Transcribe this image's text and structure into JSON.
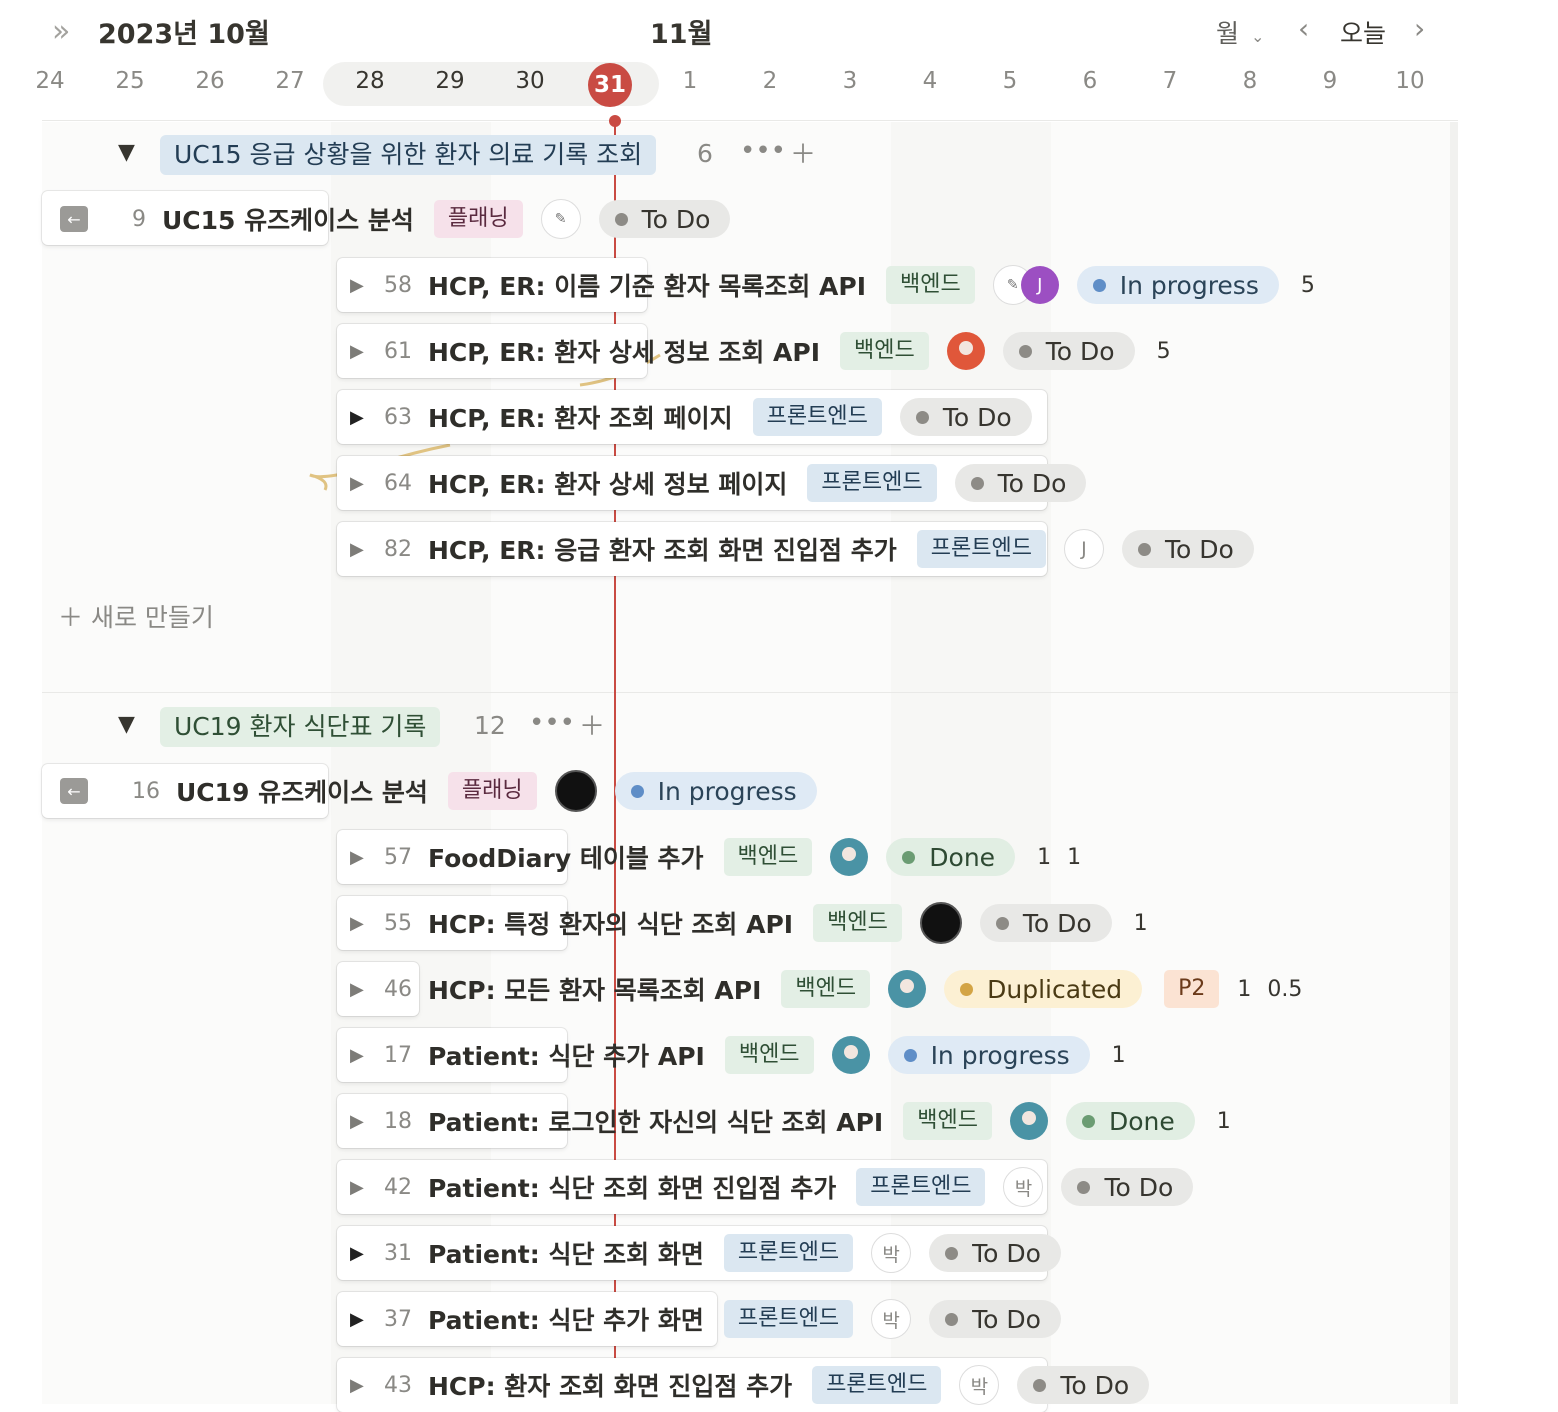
{
  "header": {
    "collapse_icon": "double-chevron-right-icon",
    "current_month": "2023년 10월",
    "next_month": "11월",
    "view_selector": "월",
    "today_button": "오늘",
    "days": [
      "24",
      "25",
      "26",
      "27",
      "28",
      "29",
      "30",
      "31",
      "1",
      "2",
      "3",
      "4",
      "5",
      "6",
      "7",
      "8",
      "9",
      "10"
    ],
    "today": "31",
    "today_color": "#c94b43"
  },
  "groups": [
    {
      "title": "UC15 응급 상황을 위한 환자 의료 기록 조회",
      "count": "6",
      "color": "#dbe7f1",
      "parent": {
        "num": "9",
        "title": "UC15 유즈케이스 분석",
        "tag": "플래닝",
        "status": "To Do"
      },
      "items": [
        {
          "num": "58",
          "title": "HCP, ER: 이름 기준 환자 목록조회 API",
          "tag": "백엔드",
          "avatars": [
            "sketch",
            "J"
          ],
          "status": "In progress",
          "extra": [
            "5"
          ]
        },
        {
          "num": "61",
          "title": "HCP, ER: 환자 상세 정보 조회 API",
          "tag": "백엔드",
          "avatars": [
            "orange"
          ],
          "status": "To Do",
          "extra": [
            "5"
          ]
        },
        {
          "num": "63",
          "title": "HCP, ER: 환자 조회 페이지",
          "tag": "프론트엔드",
          "avatars": [],
          "status": "To Do",
          "extra": []
        },
        {
          "num": "64",
          "title": "HCP, ER: 환자 상세 정보 페이지",
          "tag": "프론트엔드",
          "avatars": [],
          "status": "To Do",
          "extra": []
        },
        {
          "num": "82",
          "title": "HCP, ER: 응급 환자 조회 화면 진입점 추가",
          "tag": "프론트엔드",
          "avatars": [
            "J"
          ],
          "status": "To Do",
          "extra": []
        }
      ],
      "new_label": "새로 만들기"
    },
    {
      "title": "UC19 환자 식단표 기록",
      "count": "12",
      "color": "#e3efe5",
      "parent": {
        "num": "16",
        "title": "UC19 유즈케이스 분석",
        "tag": "플래닝",
        "status": "In progress"
      },
      "items": [
        {
          "num": "57",
          "title": "FoodDiary 테이블 추가",
          "tag": "백엔드",
          "status": "Done",
          "extra": [
            "1",
            "1"
          ]
        },
        {
          "num": "55",
          "title": "HCP: 특정 환자의 식단 조회 API",
          "tag": "백엔드",
          "status": "To Do",
          "extra": [
            "1"
          ]
        },
        {
          "num": "46",
          "title": "HCP: 모든 환자 목록조회 API",
          "tag": "백엔드",
          "status": "Duplicated",
          "priority": "P2",
          "extra": [
            "1",
            "0.5"
          ]
        },
        {
          "num": "17",
          "title": "Patient: 식단 추가 API",
          "tag": "백엔드",
          "status": "In progress",
          "extra": [
            "1"
          ]
        },
        {
          "num": "18",
          "title": "Patient: 로그인한 자신의 식단 조회 API",
          "tag": "백엔드",
          "status": "Done",
          "extra": [
            "1"
          ]
        },
        {
          "num": "42",
          "title": "Patient: 식단 조회 화면 진입점 추가",
          "tag": "프론트엔드",
          "avatar_letter": "박",
          "status": "To Do"
        },
        {
          "num": "31",
          "title": "Patient: 식단 조회 화면",
          "tag": "프론트엔드",
          "avatar_letter": "박",
          "status": "To Do"
        },
        {
          "num": "37",
          "title": "Patient: 식단 추가 화면",
          "tag": "프론트엔드",
          "avatar_letter": "박",
          "status": "To Do"
        },
        {
          "num": "43",
          "title": "HCP: 환자 조회 화면 진입점 추가",
          "tag": "프론트엔드",
          "avatar_letter": "박",
          "status": "To Do"
        }
      ]
    }
  ],
  "avatar_J": "J"
}
